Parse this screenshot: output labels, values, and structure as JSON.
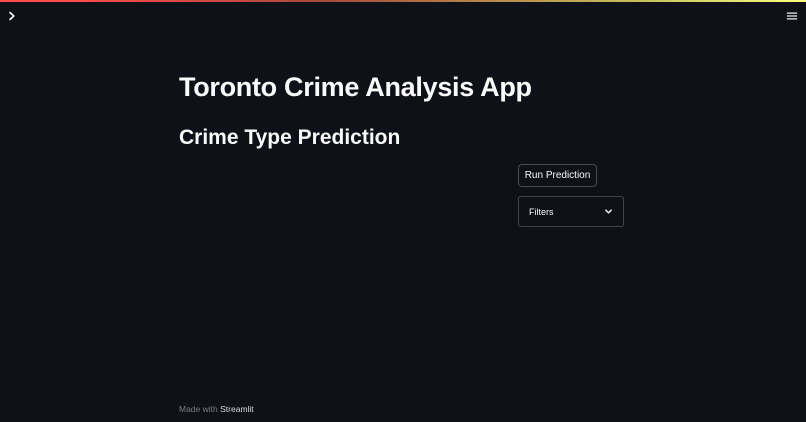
{
  "header": {
    "sidebar_toggle_icon": "chevron-right-icon",
    "menu_icon": "hamburger-menu-icon"
  },
  "main": {
    "title": "Toronto Crime Analysis App",
    "subtitle": "Crime Type Prediction",
    "run_button_label": "Run Prediction",
    "filters": {
      "label": "Filters",
      "icon": "chevron-down-icon",
      "expanded": false
    }
  },
  "footer": {
    "made_with": "Made with",
    "brand": "Streamlit"
  },
  "colors": {
    "background": "#0e1117",
    "text": "#fafafa",
    "accent": "#ff4b4b"
  }
}
